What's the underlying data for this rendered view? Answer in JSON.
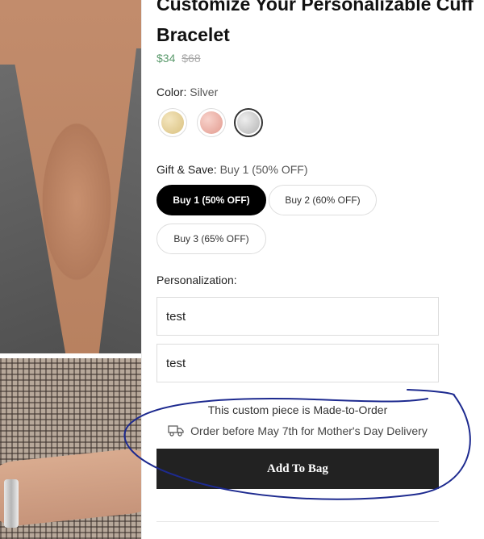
{
  "product": {
    "title": "Customize Your Personalizable Cuff Bracelet",
    "price_sale": "$34",
    "price_original": "$68"
  },
  "color": {
    "label": "Color:",
    "selected": "Silver",
    "swatches": [
      {
        "name": "Gold",
        "hex": "#e3cf98"
      },
      {
        "name": "Rose Gold",
        "hex": "#eab1a8"
      },
      {
        "name": "Silver",
        "hex": "#c9c9c9"
      }
    ]
  },
  "gift": {
    "label": "Gift & Save:",
    "selected": "Buy 1 (50% OFF)",
    "options": [
      "Buy 1 (50% OFF)",
      "Buy 2 (60% OFF)",
      "Buy 3 (65% OFF)"
    ]
  },
  "personalization": {
    "label": "Personalization:",
    "fields": [
      "test",
      "test"
    ]
  },
  "shipping": {
    "made_to_order": "This custom piece is Made-to-Order",
    "delivery": "Order before May 7th for Mother's Day Delivery",
    "delivery_icon": "truck-icon"
  },
  "actions": {
    "add_to_bag": "Add To Bag"
  },
  "colors": {
    "sale_price": "#5a9a6c",
    "button_bg": "#222222",
    "annotation_ink": "#1d2a8f"
  }
}
